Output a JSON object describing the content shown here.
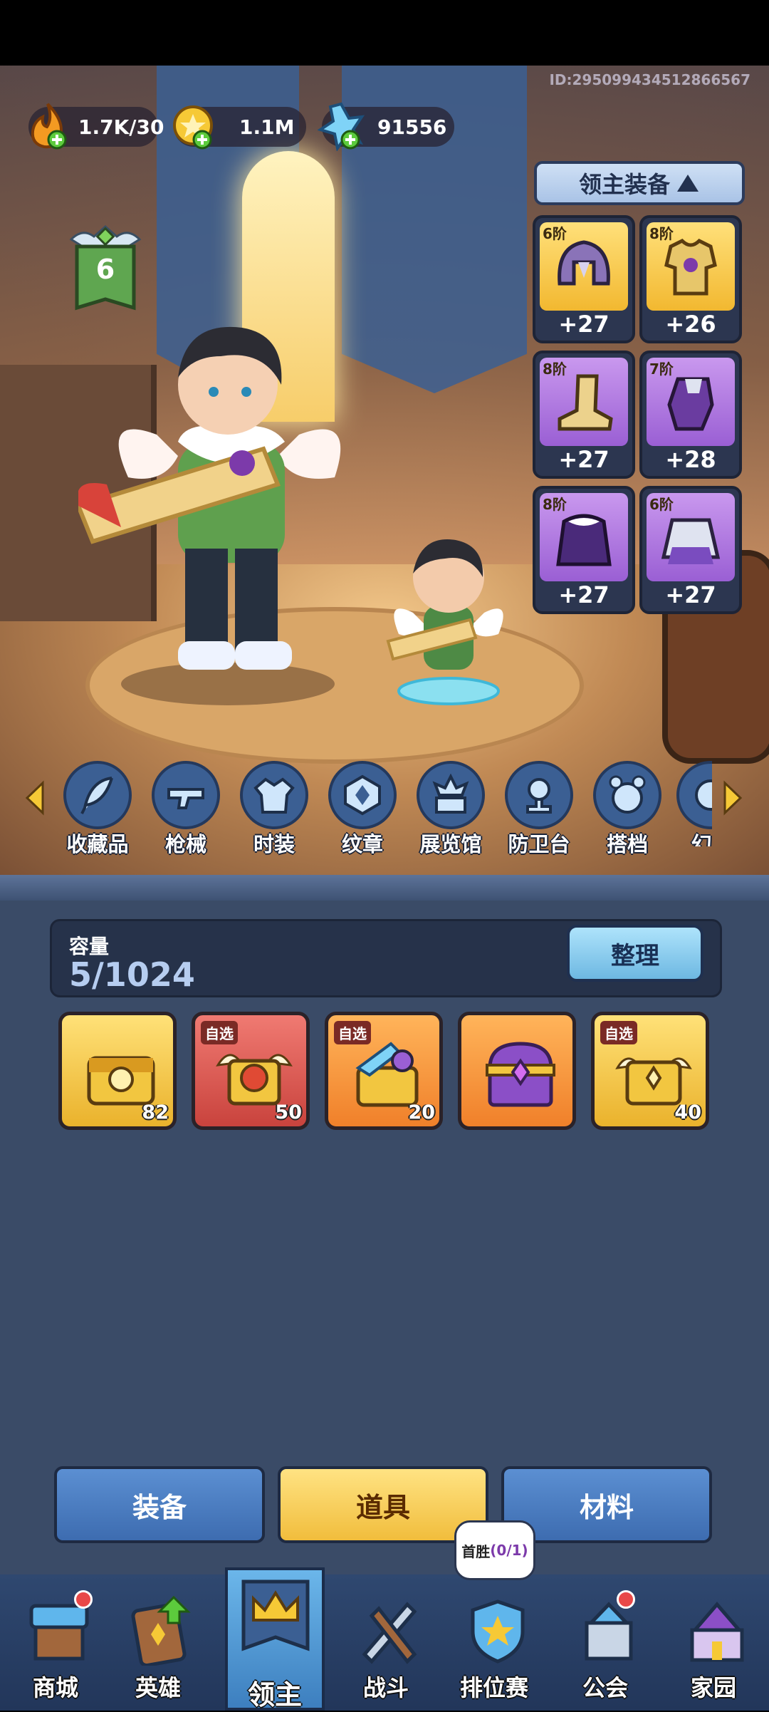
{
  "player": {
    "id": "ID:2950994345128665​67"
  },
  "resources": [
    {
      "icon": "flame-energy-icon",
      "value": "1.7K/30"
    },
    {
      "icon": "gold-coin-icon",
      "value": "1.1M"
    },
    {
      "icon": "blue-crystal-icon",
      "value": "91556"
    }
  ],
  "lord": {
    "level": "6"
  },
  "equipment_panel": {
    "title": "领主装备",
    "slots": [
      {
        "tier": "6阶",
        "bonus": "+27",
        "icon": "helmet-icon",
        "rarity": "gold"
      },
      {
        "tier": "8阶",
        "bonus": "+26",
        "icon": "armor-icon",
        "rarity": "gold"
      },
      {
        "tier": "8阶",
        "bonus": "+27",
        "icon": "boots-icon",
        "rarity": "purple"
      },
      {
        "tier": "7阶",
        "bonus": "+28",
        "icon": "gauntlet-icon",
        "rarity": "purple"
      },
      {
        "tier": "8阶",
        "bonus": "+27",
        "icon": "cape-icon",
        "rarity": "purple"
      },
      {
        "tier": "6阶",
        "bonus": "+27",
        "icon": "skirt-icon",
        "rarity": "purple"
      }
    ]
  },
  "categories": [
    {
      "label": "收藏品",
      "icon": "feather-icon"
    },
    {
      "label": "枪械",
      "icon": "gun-icon"
    },
    {
      "label": "时装",
      "icon": "coat-icon"
    },
    {
      "label": "纹章",
      "icon": "emblem-icon"
    },
    {
      "label": "展览馆",
      "icon": "exhibit-hall-icon"
    },
    {
      "label": "防卫台",
      "icon": "turret-icon"
    },
    {
      "label": "搭档",
      "icon": "partner-icon"
    },
    {
      "label": "幻",
      "icon": "illusion-icon"
    }
  ],
  "inventory": {
    "capacity_label": "容量",
    "capacity_value": "5/1024",
    "sort_label": "整理",
    "items": [
      {
        "tag": "",
        "count": "82",
        "color": "gold",
        "icon": "gold-chest-icon"
      },
      {
        "tag": "自选",
        "count": "50",
        "color": "red",
        "icon": "red-winged-chest-icon"
      },
      {
        "tag": "自选",
        "count": "20",
        "color": "orange",
        "icon": "weapon-pack-icon"
      },
      {
        "tag": "",
        "count": "",
        "color": "orange",
        "icon": "purple-treasure-chest-icon"
      },
      {
        "tag": "自选",
        "count": "40",
        "color": "gold",
        "icon": "gold-winged-chest-icon"
      }
    ]
  },
  "tabs": [
    {
      "label": "装备",
      "active": false
    },
    {
      "label": "道具",
      "active": true
    },
    {
      "label": "材料",
      "active": false
    }
  ],
  "first_win": {
    "label": "首胜",
    "progress": "(0/1)"
  },
  "nav": [
    {
      "label": "商城",
      "icon": "shop-icon",
      "badge": true
    },
    {
      "label": "英雄",
      "icon": "hero-card-icon",
      "badge": false
    },
    {
      "label": "领主",
      "icon": "lord-crown-icon",
      "badge": false,
      "active": true
    },
    {
      "label": "战斗",
      "icon": "battle-weapons-icon",
      "badge": false
    },
    {
      "label": "排位赛",
      "icon": "ranked-shield-icon",
      "badge": false
    },
    {
      "label": "公会",
      "icon": "guild-castle-icon",
      "badge": true
    },
    {
      "label": "家园",
      "icon": "home-palace-icon",
      "badge": false
    }
  ]
}
